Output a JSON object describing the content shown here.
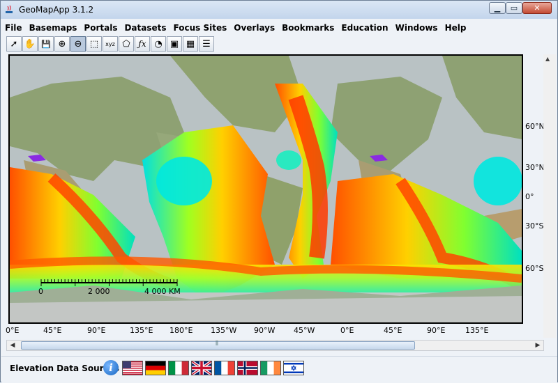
{
  "window": {
    "title": "GeoMapApp 3.1.2",
    "controls": [
      "minimize",
      "maximize",
      "close"
    ]
  },
  "menu": [
    "File",
    "Basemaps",
    "Portals",
    "Datasets",
    "Focus Sites",
    "Overlays",
    "Bookmarks",
    "Education",
    "Windows",
    "Help"
  ],
  "toolbar": [
    {
      "name": "select-arrow-icon",
      "glyph": "➚"
    },
    {
      "name": "pan-hand-icon",
      "glyph": "✋"
    },
    {
      "name": "save-icon",
      "glyph": "💾"
    },
    {
      "name": "zoom-in-icon",
      "glyph": "⊕"
    },
    {
      "name": "zoom-out-icon",
      "glyph": "⊖"
    },
    {
      "name": "frame-icon",
      "glyph": "⬚"
    },
    {
      "name": "xyz-icon",
      "glyph": "xyz"
    },
    {
      "name": "lasso-icon",
      "glyph": "⬠"
    },
    {
      "name": "function-icon",
      "glyph": "ƒx"
    },
    {
      "name": "profile-icon",
      "glyph": "◔"
    },
    {
      "name": "overlay-icon",
      "glyph": "▣"
    },
    {
      "name": "grid-icon",
      "glyph": "▦"
    },
    {
      "name": "layers-list-icon",
      "glyph": "☰"
    }
  ],
  "map": {
    "lat_labels": [
      "60°N",
      "30°N",
      "0°",
      "30°S",
      "60°S"
    ],
    "lon_labels": [
      "0°E",
      "45°E",
      "90°E",
      "135°E",
      "180°E",
      "135°W",
      "90°W",
      "45°W",
      "0°E",
      "45°E",
      "90°E",
      "135°E"
    ],
    "scale_labels": [
      "0",
      "2 000",
      "4 000 KM"
    ]
  },
  "bottom": {
    "label": "Elevation Data Sources",
    "info_glyph": "i",
    "flags": [
      "usa-flag",
      "germany-flag",
      "italy-flag",
      "uk-flag",
      "france-flag",
      "norway-flag",
      "ireland-flag",
      "israel-flag"
    ]
  },
  "colors": {
    "ocean_hot": "#ff4000",
    "ocean_mid": "#ffd000",
    "ocean_cool": "#00e0e0",
    "land": "#7f9a6a"
  }
}
